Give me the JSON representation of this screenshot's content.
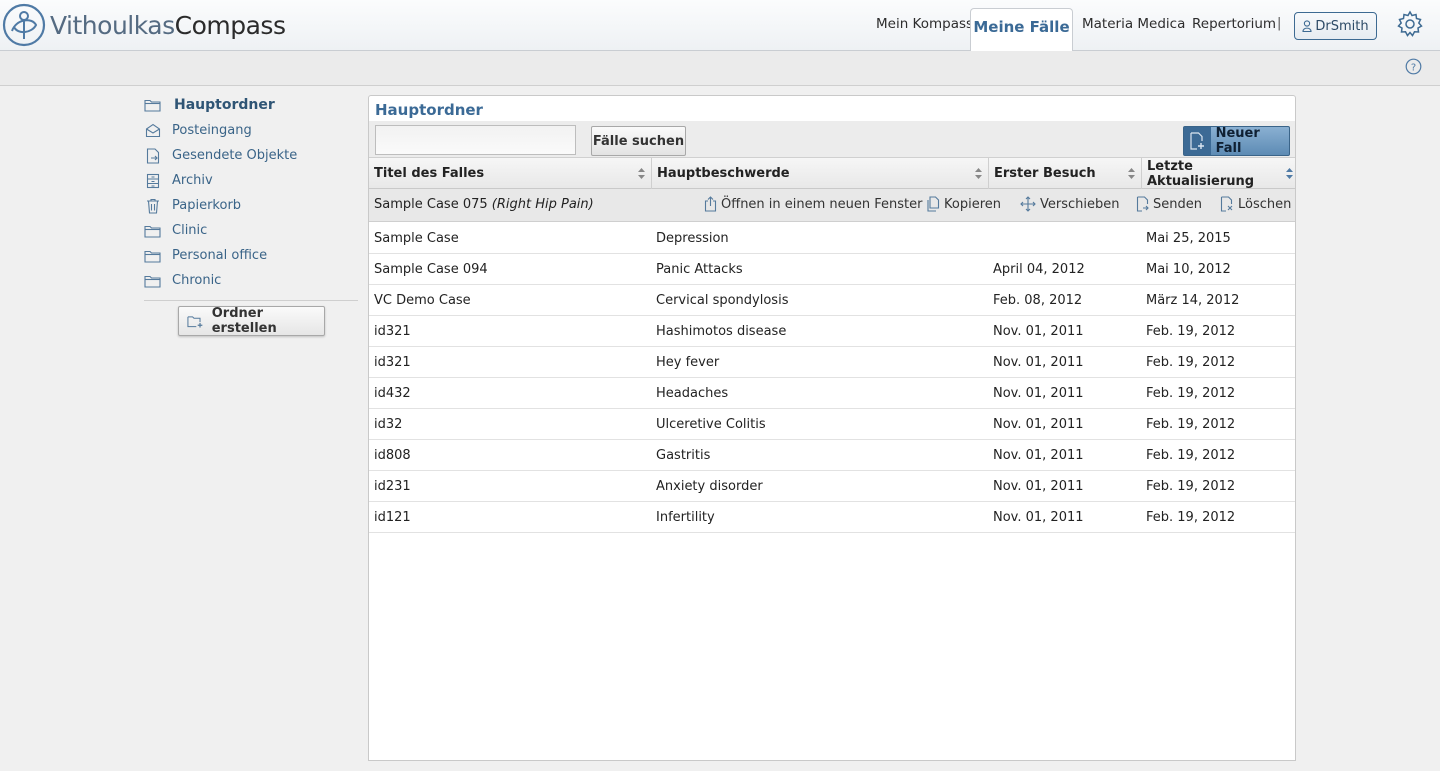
{
  "app": {
    "logo_part1": "Vithoulkas",
    "logo_part2": "Compass"
  },
  "nav": {
    "items": [
      "Mein Kompass",
      "Meine Fälle",
      "Materia Medica",
      "Repertorium"
    ],
    "active": "Meine Fälle",
    "separator": "|",
    "user": "DrSmith",
    "icons": {
      "user": "user-icon",
      "settings": "gear-icon",
      "help": "help-icon"
    }
  },
  "sidebar": {
    "root": "Hauptordner",
    "items": [
      {
        "label": "Posteingang",
        "icon": "inbox-icon"
      },
      {
        "label": "Gesendete Objekte",
        "icon": "sent-icon"
      },
      {
        "label": "Archiv",
        "icon": "archive-icon"
      },
      {
        "label": "Papierkorb",
        "icon": "trash-icon"
      },
      {
        "label": "Clinic",
        "icon": "folder-icon"
      },
      {
        "label": "Personal office",
        "icon": "folder-icon"
      },
      {
        "label": "Chronic",
        "icon": "folder-icon"
      }
    ],
    "create_folder": "Ordner erstellen"
  },
  "main": {
    "title": "Hauptordner",
    "search": {
      "value": "",
      "button": "Fälle suchen"
    },
    "new_case": "Neuer Fall",
    "columns": [
      "Titel des Falles",
      "Hauptbeschwerde",
      "Erster Besuch",
      "Letzte Aktualisierung"
    ],
    "selected": {
      "title": "Sample Case 075",
      "complaint": "(Right Hip Pain)",
      "actions": [
        "Öffnen in einem neuen Fenster",
        "Kopieren",
        "Verschieben",
        "Senden",
        "Löschen"
      ]
    },
    "rows": [
      [
        "Sample Case",
        "Depression",
        "",
        "Mai 25, 2015"
      ],
      [
        "Sample Case 094",
        "Panic Attacks",
        "April 04, 2012",
        "Mai 10, 2012"
      ],
      [
        "VC Demo Case",
        "Cervical spondylosis",
        "Feb. 08, 2012",
        "März 14, 2012"
      ],
      [
        "id321",
        "Hashimotos disease",
        "Nov. 01, 2011",
        "Feb. 19, 2012"
      ],
      [
        "id321",
        "Hey fever",
        "Nov. 01, 2011",
        "Feb. 19, 2012"
      ],
      [
        "id432",
        "Headaches",
        "Nov. 01, 2011",
        "Feb. 19, 2012"
      ],
      [
        "id32",
        "Ulceretive Colitis",
        "Nov. 01, 2011",
        "Feb. 19, 2012"
      ],
      [
        "id808",
        "Gastritis",
        "Nov. 01, 2011",
        "Feb. 19, 2012"
      ],
      [
        "id231",
        "Anxiety disorder",
        "Nov. 01, 2011",
        "Feb. 19, 2012"
      ],
      [
        "id121",
        "Infertility",
        "Nov. 01, 2011",
        "Feb. 19, 2012"
      ]
    ]
  },
  "colors": {
    "accent": "#3b6a96",
    "link": "#3a6488",
    "button_primary": "#5d8bb4"
  }
}
